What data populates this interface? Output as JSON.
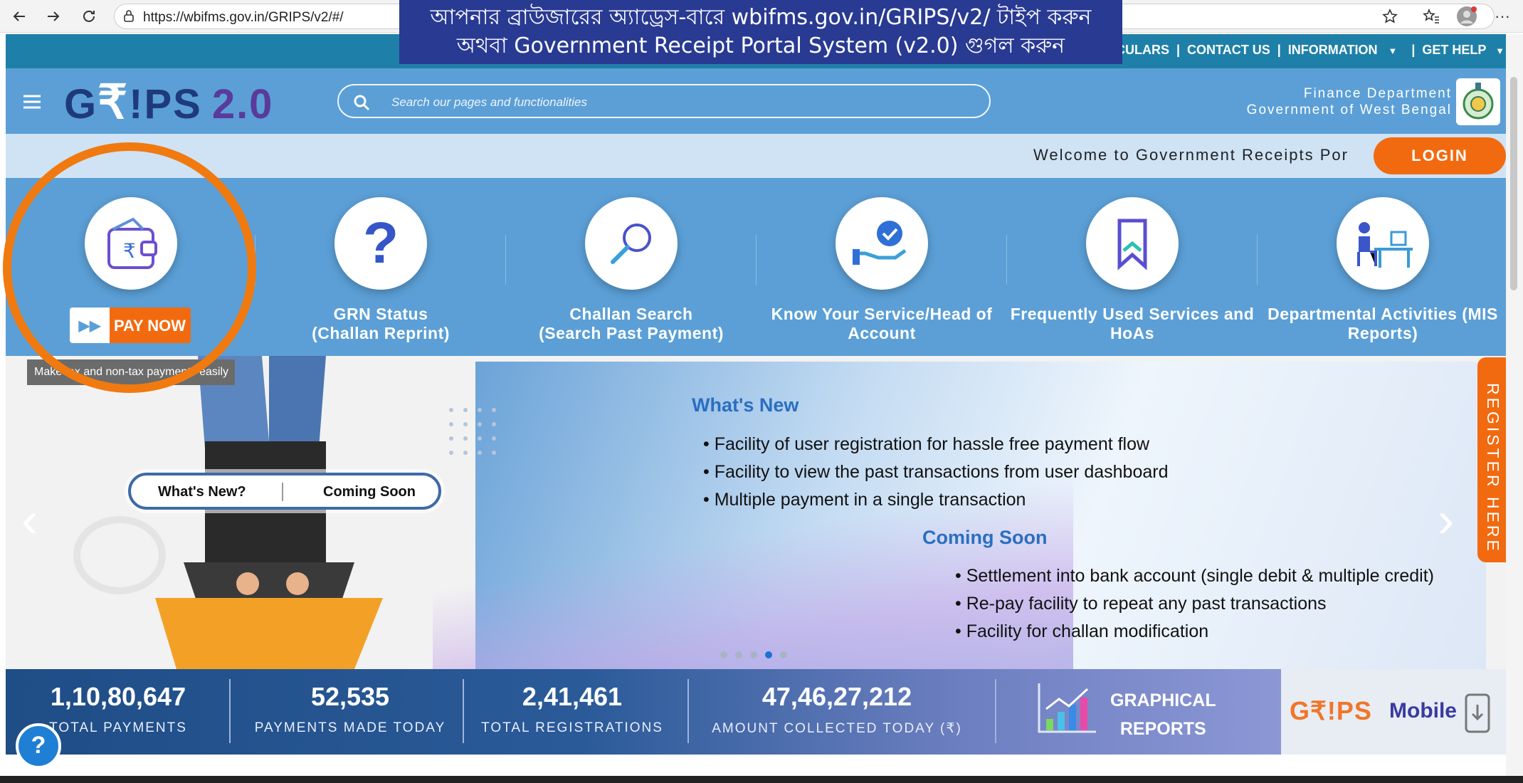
{
  "browser": {
    "url": "https://wbifms.gov.in/GRIPS/v2/#/"
  },
  "banner": {
    "line1": "আপনার ব্রাউজারের অ্যাড্রেস-বারে wbifms.gov.in/GRIPS/v2/ টাইপ করুন",
    "line2": "অথবা  Government Receipt Portal System (v2.0) গুগল করুন"
  },
  "top_links": {
    "circulars": "CIRCULARS",
    "contact": "CONTACT US",
    "information": "INFORMATION",
    "help": "GET HELP",
    "sep": "|"
  },
  "header": {
    "logo_g": "G",
    "logo_rupee": "₹",
    "logo_rest": "!PS",
    "logo_version": "2.0",
    "search_placeholder": "Search our pages and functionalities",
    "dept_line1": "Finance Department",
    "dept_line2": "Government of West Bengal"
  },
  "welcome": {
    "text": "Welcome to Government Receipts Por",
    "login": "LOGIN"
  },
  "services": [
    {
      "label": "",
      "icon": "wallet-rupee-icon"
    },
    {
      "label": "GRN Status\n(Challan Reprint)",
      "icon": "question-icon"
    },
    {
      "label": "Challan Search\n(Search Past Payment)",
      "icon": "magnifier-icon"
    },
    {
      "label": "Know Your Service/Head of\nAccount",
      "icon": "hand-check-icon"
    },
    {
      "label": "Frequently Used Services and\nHoAs",
      "icon": "bookmark-icon"
    },
    {
      "label": "Departmental Activities (MIS\nReports)",
      "icon": "desk-person-icon"
    }
  ],
  "pay_now": {
    "label": "PAY NOW",
    "tooltip": "Make tax and non-tax payments easily"
  },
  "carousel": {
    "pill_left": "What's New?",
    "pill_right": "Coming Soon",
    "whats_new_title": "What's New",
    "whats_new": [
      "Facility of user registration for hassle free payment flow",
      "Facility to view the past transactions from user dashboard",
      "Multiple payment in a single transaction"
    ],
    "coming_soon_title": "Coming Soon",
    "coming_soon": [
      "Settlement into bank account (single debit & multiple credit)",
      "Re-pay facility to repeat any past transactions",
      "Facility for challan modification"
    ],
    "register": "REGISTER HERE",
    "dot_count": 5,
    "active_dot": 4
  },
  "stats": [
    {
      "value": "1,10,80,647",
      "label": "TOTAL PAYMENTS"
    },
    {
      "value": "52,535",
      "label": "PAYMENTS MADE TODAY"
    },
    {
      "value": "2,41,461",
      "label": "TOTAL REGISTRATIONS"
    },
    {
      "value": "47,46,27,212",
      "label": "AMOUNT COLLECTED TODAY (₹)"
    }
  ],
  "graphical": {
    "line1": "GRAPHICAL",
    "line2": "REPORTS"
  },
  "mobile": {
    "logo": "G₹!PS",
    "text": "Mobile"
  },
  "help_icon": "?",
  "colors": {
    "accent": "#f26a10",
    "header_blue": "#5b9fd6",
    "topbar": "#1e80a8",
    "banner": "#293a93"
  }
}
